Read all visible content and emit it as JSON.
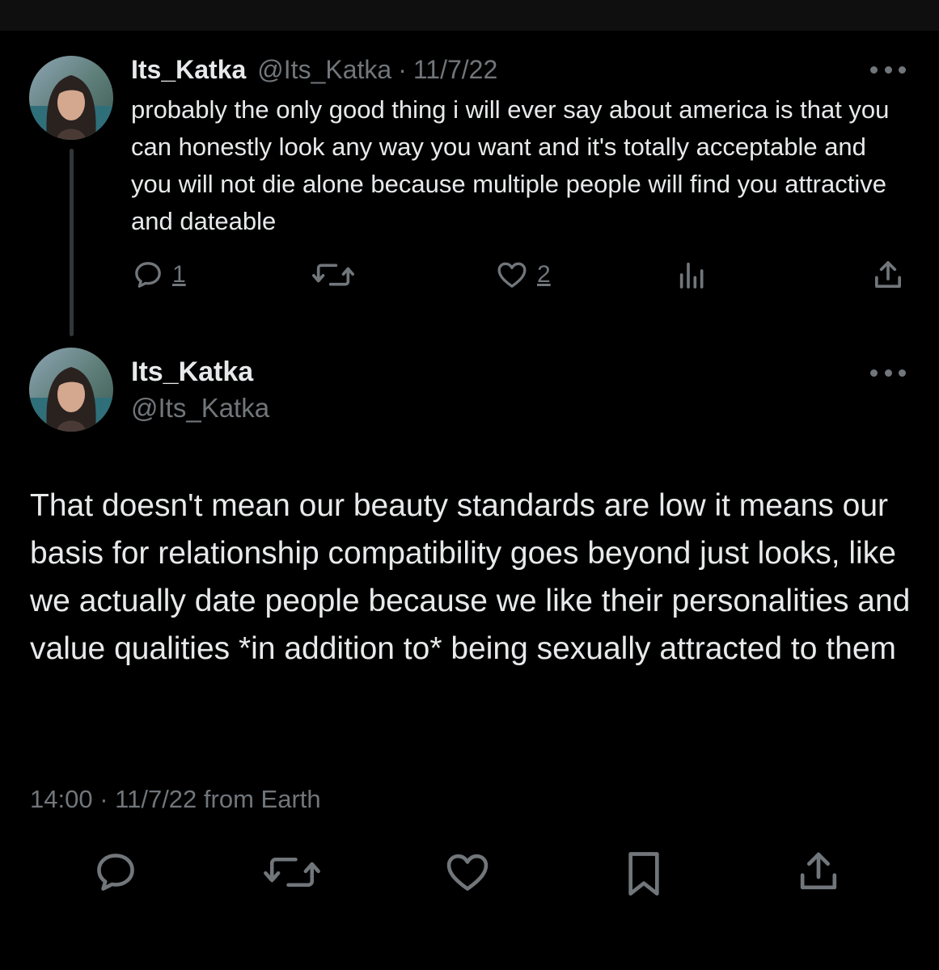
{
  "parent_tweet": {
    "display_name": "Its_Katka",
    "handle": "@Its_Katka",
    "separator": "·",
    "date": "11/7/22",
    "text": "probably the only good thing i will ever say about america is that you can honestly look any way you want and it's totally acceptable and you will not die alone because multiple people will find you attractive and dateable",
    "actions": {
      "reply_icon": "reply-bubble-icon",
      "reply_count": "1",
      "retweet_icon": "retweet-icon",
      "like_icon": "heart-icon",
      "like_count": "2",
      "views_icon": "analytics-bars-icon",
      "share_icon": "share-upload-icon"
    },
    "more_icon": "more-dots-icon"
  },
  "main_tweet": {
    "display_name": "Its_Katka",
    "handle": "@Its_Katka",
    "text": "That doesn't mean our beauty standards are low it means our basis for relationship compatibility goes beyond just looks, like we actually date people because we like their personalities and value qualities *in addition to* being sexually attracted to them",
    "time": "14:00",
    "separator": "·",
    "date": "11/7/22",
    "source": "from Earth",
    "more_icon": "more-dots-icon"
  },
  "action_bar": {
    "icons": [
      "reply-bubble-icon",
      "retweet-icon",
      "heart-icon",
      "bookmark-icon",
      "share-upload-icon"
    ]
  },
  "colors": {
    "background": "#000000",
    "text_primary": "#e7e9ea",
    "text_muted": "#71767b",
    "thread_line": "#333639"
  }
}
